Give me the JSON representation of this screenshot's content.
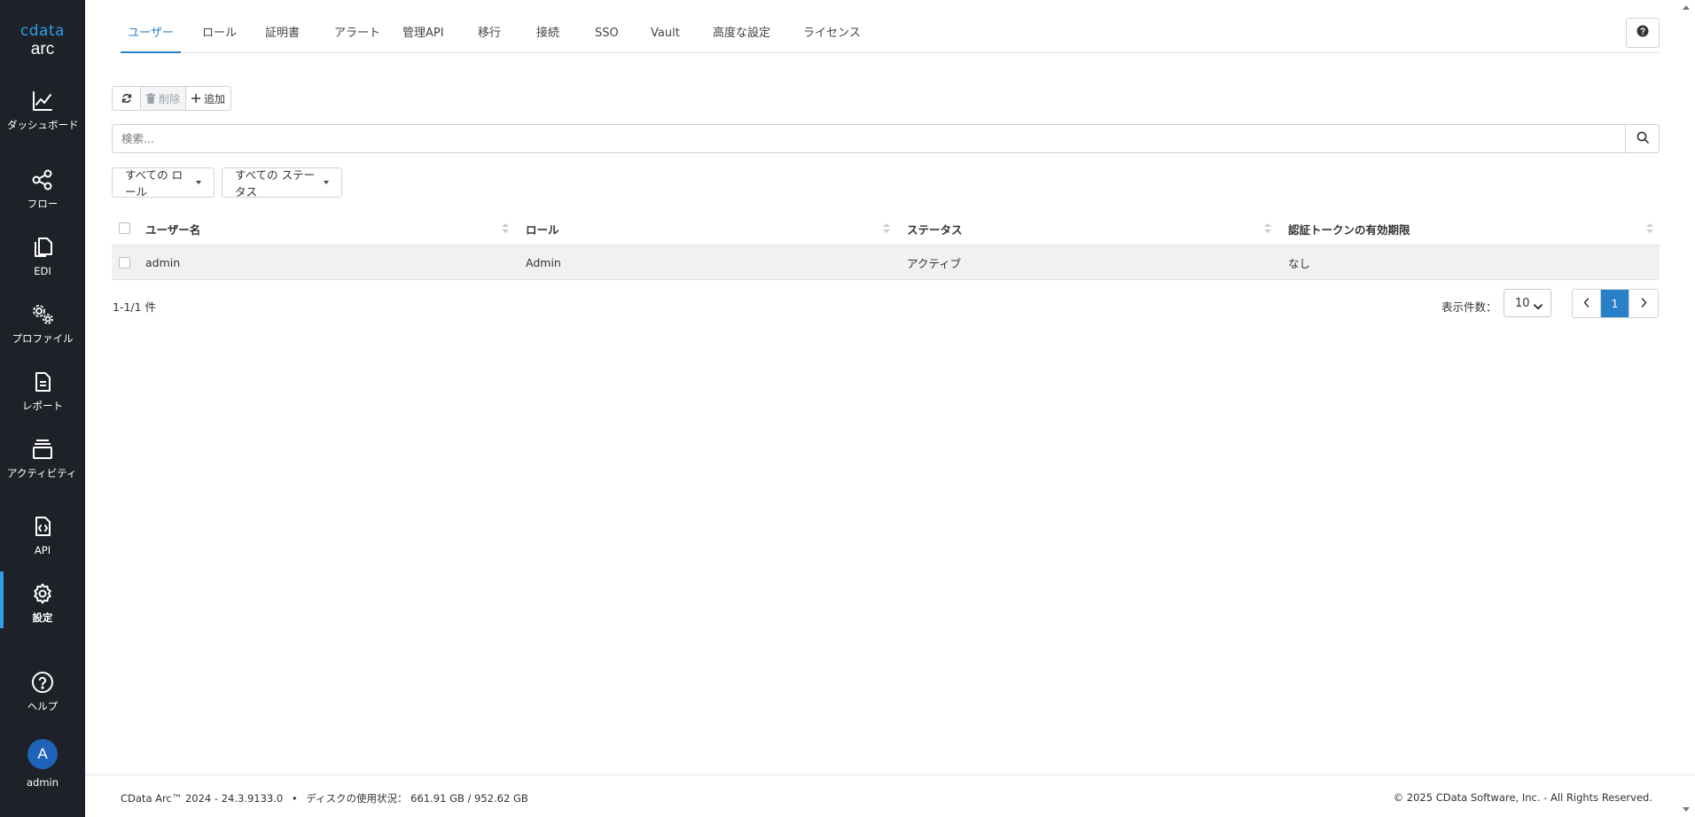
{
  "brand": {
    "name": "cdata",
    "product": "arc"
  },
  "sidebar": {
    "items": [
      {
        "label": "ダッシュボード",
        "icon": "chart-line-icon"
      },
      {
        "label": "フロー",
        "icon": "share-nodes-icon"
      },
      {
        "label": "EDI",
        "icon": "copy-icon"
      },
      {
        "label": "プロファイル",
        "icon": "gears-icon"
      },
      {
        "label": "レポート",
        "icon": "file-text-icon"
      },
      {
        "label": "アクティビティ",
        "icon": "stack-icon"
      },
      {
        "label": "API",
        "icon": "file-code-icon"
      },
      {
        "label": "設定",
        "icon": "gear-icon",
        "active": true
      },
      {
        "label": "ヘルプ",
        "icon": "question-circle-icon"
      }
    ],
    "user": {
      "initial": "A",
      "name": "admin"
    }
  },
  "tabs": [
    {
      "label": "ユーザー",
      "active": true
    },
    {
      "label": "ロール"
    },
    {
      "label": "証明書"
    },
    {
      "label": "アラート"
    },
    {
      "label": "管理API"
    },
    {
      "label": "移行"
    },
    {
      "label": "接続"
    },
    {
      "label": "SSO"
    },
    {
      "label": "Vault"
    },
    {
      "label": "高度な設定"
    },
    {
      "label": "ライセンス"
    }
  ],
  "toolbar": {
    "refresh_icon": "refresh-icon",
    "delete_label": "削除",
    "add_label": "追加"
  },
  "search": {
    "placeholder": "検索..."
  },
  "filters": {
    "role": "すべての ロール",
    "status": "すべての ステータス"
  },
  "table": {
    "columns": [
      "ユーザー名",
      "ロール",
      "ステータス",
      "認証トークンの有効期限"
    ],
    "rows": [
      {
        "username": "admin",
        "role": "Admin",
        "status": "アクティブ",
        "token_expiry": "なし"
      }
    ]
  },
  "pagination": {
    "count_text": "1-1/1 件",
    "per_page_label": "表示件数：",
    "per_page_value": "10",
    "current_page": "1"
  },
  "footer": {
    "version": "CData Arc™ 2024 - 24.3.9133.0",
    "bullet": "•",
    "disk_label": "ディスクの使用状況：",
    "disk_value": "661.91 GB / 952.62 GB",
    "copyright": "© 2025 CData Software, Inc. - All Rights Reserved."
  },
  "colors": {
    "sidebar_bg": "#1e2228",
    "accent": "#2a80c7",
    "brand_blue": "#2f9ee8",
    "avatar_bg": "#1f63b8"
  }
}
